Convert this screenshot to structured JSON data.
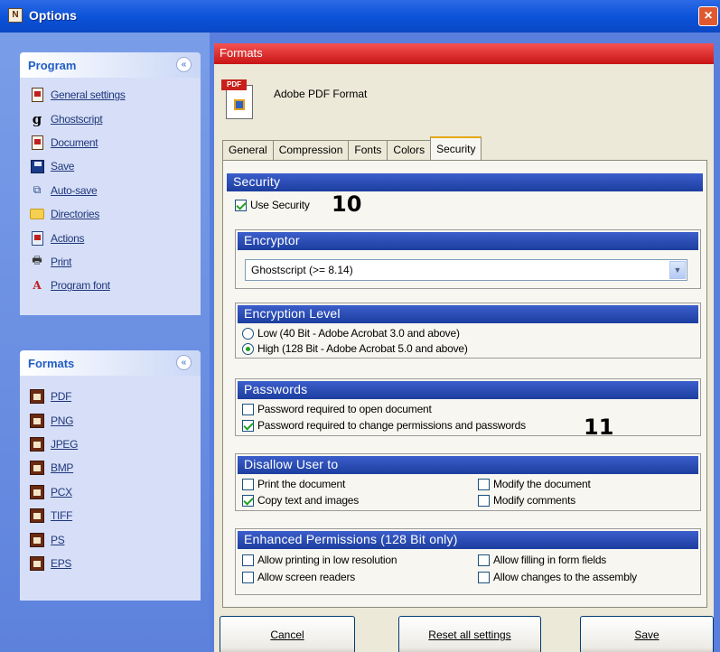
{
  "window": {
    "title": "Options",
    "app_icon": "app-logo-icon",
    "close_icon": "×"
  },
  "program_group": {
    "title": "Program",
    "collapse_icon": "«",
    "items": [
      {
        "label": "General settings",
        "icon": "settings-doc-icon"
      },
      {
        "label": "Ghostscript",
        "icon": "ghostscript-icon"
      },
      {
        "label": "Document",
        "icon": "document-icon"
      },
      {
        "label": "Save",
        "icon": "floppy-icon"
      },
      {
        "label": "Auto-save",
        "icon": "network-icon"
      },
      {
        "label": "Directories",
        "icon": "folder-icon"
      },
      {
        "label": "Actions",
        "icon": "actions-icon"
      },
      {
        "label": "Print",
        "icon": "printer-icon"
      },
      {
        "label": "Program font",
        "icon": "font-icon"
      }
    ]
  },
  "formats_group": {
    "title": "Formats",
    "collapse_icon": "«",
    "items": [
      {
        "label": "PDF"
      },
      {
        "label": "PNG"
      },
      {
        "label": "JPEG"
      },
      {
        "label": "BMP"
      },
      {
        "label": "PCX"
      },
      {
        "label": "TIFF"
      },
      {
        "label": "PS"
      },
      {
        "label": "EPS"
      }
    ]
  },
  "formats_panel": {
    "header": "Formats",
    "format_name": "Adobe PDF Format",
    "pdf_tag": "PDF",
    "tabs": [
      {
        "label": "General",
        "active": false
      },
      {
        "label": "Compression",
        "active": false
      },
      {
        "label": "Fonts",
        "active": false
      },
      {
        "label": "Colors",
        "active": false
      },
      {
        "label": "Security",
        "active": true
      }
    ]
  },
  "security": {
    "header": "Security",
    "use_security": {
      "label": "Use Security",
      "checked": true
    },
    "marker_10": "10",
    "encryptor": {
      "header": "Encryptor",
      "selected": "Ghostscript (>= 8.14)",
      "arrow": "▼"
    },
    "encryption_level": {
      "header": "Encryption Level",
      "low": {
        "label": "Low (40 Bit - Adobe Acrobat 3.0 and above)",
        "selected": false
      },
      "high": {
        "label": "High (128 Bit - Adobe Acrobat 5.0 and above)",
        "selected": true
      }
    },
    "passwords": {
      "header": "Passwords",
      "open": {
        "label": "Password required to open document",
        "checked": false
      },
      "change": {
        "label": "Password required to change permissions and passwords",
        "checked": true
      }
    },
    "marker_11": "11",
    "disallow": {
      "header": "Disallow User to",
      "print": {
        "label": "Print the document",
        "checked": false
      },
      "copy": {
        "label": "Copy text and images",
        "checked": true
      },
      "modify_doc": {
        "label": "Modify the document",
        "checked": false
      },
      "modify_comments": {
        "label": "Modify comments",
        "checked": false
      }
    },
    "enhanced": {
      "header": "Enhanced Permissions (128 Bit only)",
      "low_res": {
        "label": "Allow printing in low resolution",
        "checked": false
      },
      "screen_readers": {
        "label": "Allow screen readers",
        "checked": false
      },
      "form_fields": {
        "label": "Allow filling in form fields",
        "checked": false
      },
      "assembly": {
        "label": "Allow changes to the assembly",
        "checked": false
      }
    }
  },
  "buttons": {
    "cancel": "Cancel",
    "reset": "Reset all settings",
    "save": "Save"
  }
}
